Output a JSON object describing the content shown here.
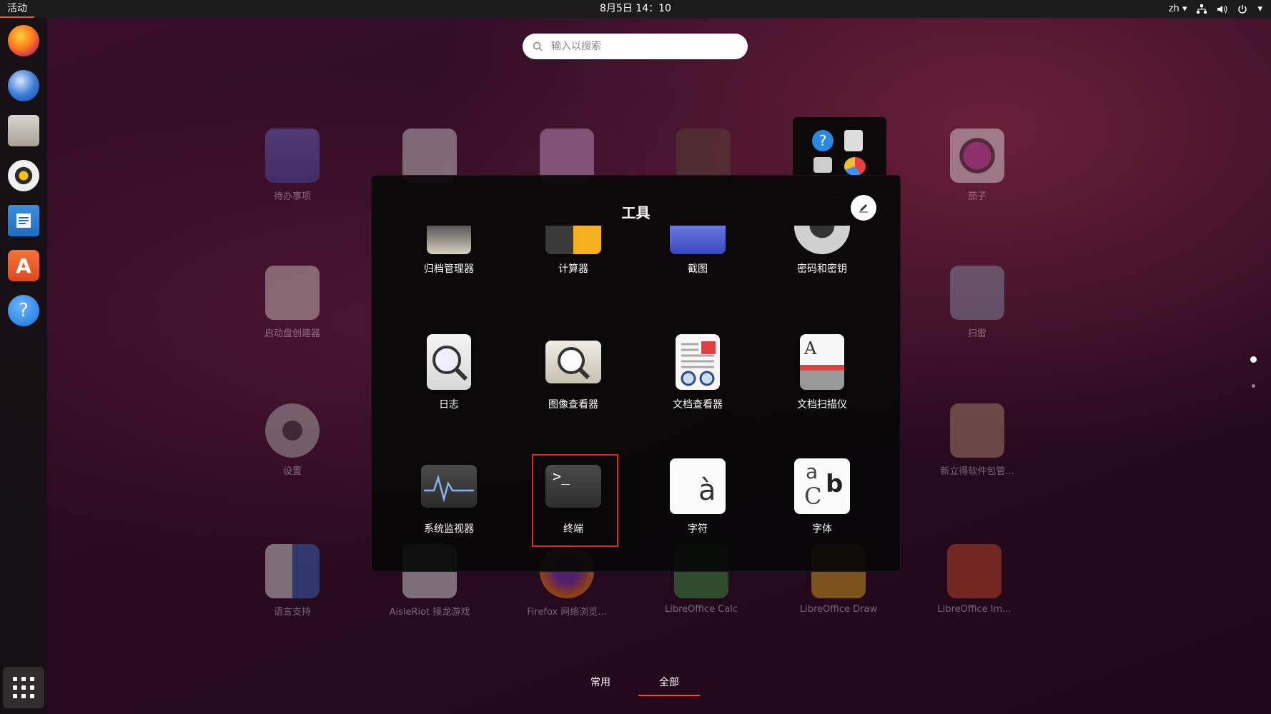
{
  "topbar": {
    "activities": "活动",
    "clock": "8月5日  14：10",
    "language": "zh",
    "icons": [
      "network-icon",
      "volume-icon",
      "power-icon",
      "chevron-down-icon"
    ]
  },
  "dock": {
    "apps": [
      "firefox",
      "thunderbird",
      "files",
      "rhythmbox",
      "libreoffice-writer",
      "ubuntu-software",
      "help"
    ],
    "show_apps": "show-applications"
  },
  "search": {
    "placeholder": "输入以搜索"
  },
  "background_apps": [
    {
      "label": "待办事项"
    },
    {
      "label": ""
    },
    {
      "label": ""
    },
    {
      "label": ""
    },
    {
      "label": "工具"
    },
    {
      "label": "茄子"
    },
    {
      "label": "启动盘创建器"
    },
    {
      "label": "扫雷"
    },
    {
      "label": "设置"
    },
    {
      "label": "新立得软件包管..."
    },
    {
      "label": "语言支持"
    },
    {
      "label": "AisleRiot 接龙游戏"
    },
    {
      "label": "Firefox 网络浏览..."
    },
    {
      "label": "LibreOffice Calc"
    },
    {
      "label": "LibreOffice Draw"
    },
    {
      "label": "LibreOffice Im..."
    }
  ],
  "folder": {
    "title": "工具",
    "apps": [
      {
        "label": "归档管理器"
      },
      {
        "label": "计算器"
      },
      {
        "label": "截图"
      },
      {
        "label": "密码和密钥"
      },
      {
        "label": "日志"
      },
      {
        "label": "图像查看器"
      },
      {
        "label": "文档查看器"
      },
      {
        "label": "文档扫描仪"
      },
      {
        "label": "系统监视器"
      },
      {
        "label": "终端"
      },
      {
        "label": "字符"
      },
      {
        "label": "字体"
      }
    ],
    "highlighted": "终端"
  },
  "tabs": {
    "frequent": "常用",
    "all": "全部",
    "active": "全部"
  },
  "colors": {
    "accent": "#e95420",
    "highlight": "#e0281e"
  }
}
